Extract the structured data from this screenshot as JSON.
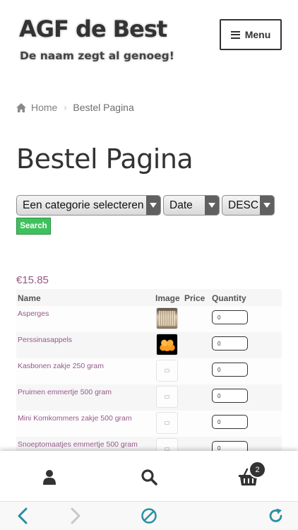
{
  "site": {
    "title": "AGF de Best",
    "description": "De naam zegt al genoeg!"
  },
  "header": {
    "menu_label": "Menu",
    "menu_icon": "hamburger-icon"
  },
  "breadcrumb": {
    "home_icon": "home-icon",
    "home": "Home",
    "separator": "›",
    "current": "Bestel Pagina"
  },
  "page": {
    "title": "Bestel Pagina"
  },
  "filters": {
    "category": "Een categorie selecteren",
    "sort_by": "Date",
    "order": "DESC",
    "search_label": "Search"
  },
  "cart_total": "€15.85",
  "table": {
    "headers": {
      "name": "Name",
      "image": "Image",
      "price": "Price",
      "quantity": "Quantity"
    },
    "rows": [
      {
        "name": "Asperges",
        "image": "asparagus-photo",
        "quantity": "0"
      },
      {
        "name": "Perssinasappels",
        "image": "oranges-photo",
        "quantity": "0"
      },
      {
        "name": "Kasbonen zakje 250 gram",
        "image": "placeholder",
        "quantity": "0"
      },
      {
        "name": "Pruimen emmertje 500 gram",
        "image": "placeholder",
        "quantity": "0"
      },
      {
        "name": "Mini Komkommers zakje 500 gram",
        "image": "placeholder",
        "quantity": "0"
      },
      {
        "name": "Snoeptomaatjes emmertje 500 gram",
        "image": "placeholder",
        "quantity": "0"
      }
    ]
  },
  "bottom_nav": {
    "account_icon": "user-icon",
    "search_icon": "search-icon",
    "cart_icon": "basket-icon",
    "cart_count": "2"
  },
  "browser": {
    "back_icon": "chevron-left-icon",
    "forward_icon": "chevron-right-icon",
    "stop_icon": "stop-icon",
    "reload_icon": "reload-icon"
  },
  "colors": {
    "accent_link": "#96588a",
    "search_button": "#3ec15d",
    "browser_controls": "#2a8ea3"
  }
}
